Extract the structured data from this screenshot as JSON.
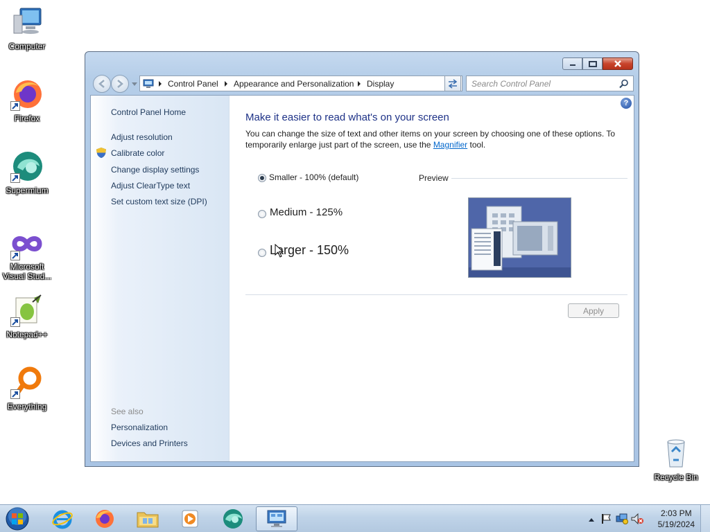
{
  "desktop": {
    "icons": [
      {
        "label": "Computer"
      },
      {
        "label": "Firefox"
      },
      {
        "label": "Supermium"
      },
      {
        "label": "Microsoft Visual Stud..."
      },
      {
        "label": "Notepad++"
      },
      {
        "label": "Everything"
      },
      {
        "label": "Recycle Bin"
      }
    ]
  },
  "window": {
    "breadcrumb": [
      "Control Panel",
      "Appearance and Personalization",
      "Display"
    ],
    "search_placeholder": "Search Control Panel",
    "sidebar": {
      "home_label": "Control Panel Home",
      "links": [
        "Adjust resolution",
        "Calibrate color",
        "Change display settings",
        "Adjust ClearType text",
        "Set custom text size (DPI)"
      ],
      "see_also_label": "See also",
      "see_also_links": [
        "Personalization",
        "Devices and Printers"
      ]
    },
    "main": {
      "heading": "Make it easier to read what's on your screen",
      "description_before": "You can change the size of text and other items on your screen by choosing one of these options. To temporarily enlarge just part of the screen, use the ",
      "description_link": "Magnifier",
      "description_after": " tool.",
      "options": [
        {
          "label": "Smaller - 100% (default)",
          "selected": true
        },
        {
          "label": "Medium - 125%",
          "selected": false
        },
        {
          "label": "Larger - 150%",
          "selected": false
        }
      ],
      "preview_label": "Preview",
      "apply_label": "Apply",
      "help_glyph": "?"
    }
  },
  "taskbar": {
    "items": [
      "start-button",
      "internet-explorer",
      "firefox",
      "file-explorer",
      "media-player",
      "supermium",
      "control-panel"
    ],
    "active_item": "control-panel",
    "clock": {
      "time": "2:03 PM",
      "date": "5/19/2024"
    }
  },
  "colors": {
    "heading_blue": "#1e3287",
    "link_blue": "#0066cc",
    "sidebar_link": "#1e395b",
    "window_frame": "#b4cde8",
    "taskbar": "#bfd3e8"
  }
}
